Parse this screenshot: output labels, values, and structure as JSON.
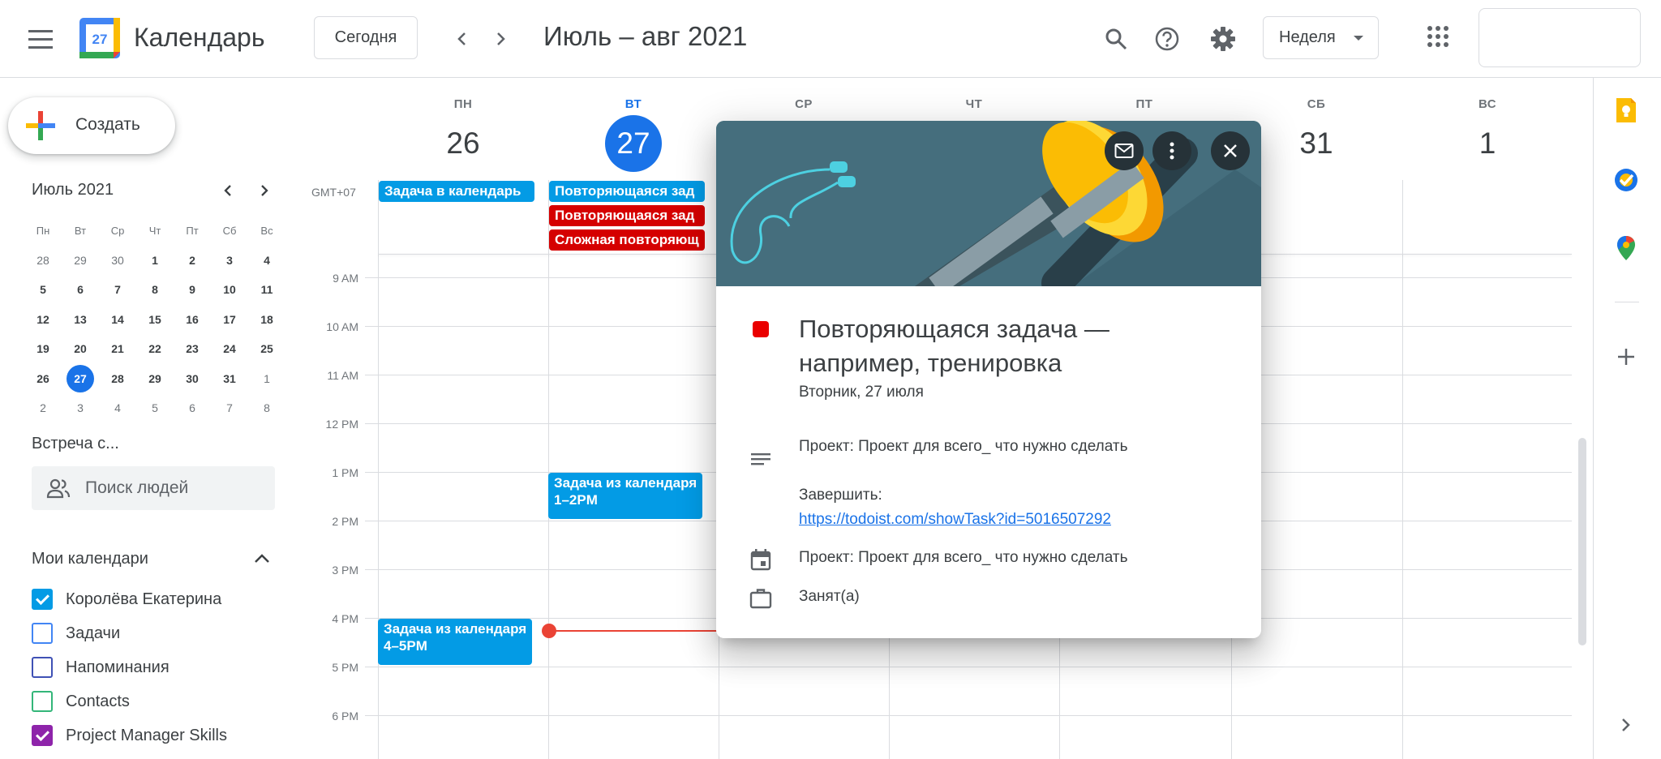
{
  "header": {
    "app_title": "Календарь",
    "logo_day": "27",
    "today_label": "Сегодня",
    "date_range": "Июль – авг 2021",
    "view_label": "Неделя"
  },
  "sidebar": {
    "create_label": "Создать",
    "mini_month": "Июль 2021",
    "weekday_heads": [
      "Пн",
      "Вт",
      "Ср",
      "Чт",
      "Пт",
      "Сб",
      "Вс"
    ],
    "weeks": [
      [
        "28",
        "29",
        "30",
        "1",
        "2",
        "3",
        "4"
      ],
      [
        "5",
        "6",
        "7",
        "8",
        "9",
        "10",
        "11"
      ],
      [
        "12",
        "13",
        "14",
        "15",
        "16",
        "17",
        "18"
      ],
      [
        "19",
        "20",
        "21",
        "22",
        "23",
        "24",
        "25"
      ],
      [
        "26",
        "27",
        "28",
        "29",
        "30",
        "31",
        "1"
      ],
      [
        "2",
        "3",
        "4",
        "5",
        "6",
        "7",
        "8"
      ]
    ],
    "meet_title": "Встреча с...",
    "people_search_placeholder": "Поиск людей",
    "my_calendars_title": "Мои календари",
    "calendars": [
      {
        "label": "Королёва Екатерина",
        "color": "#039be5",
        "checked": true
      },
      {
        "label": "Задачи",
        "color": "#4285f4",
        "checked": false
      },
      {
        "label": "Напоминания",
        "color": "#3f51b5",
        "checked": false
      },
      {
        "label": "Contacts",
        "color": "#33b679",
        "checked": false
      },
      {
        "label": "Project Manager Skills",
        "color": "#8e24aa",
        "checked": true
      }
    ]
  },
  "grid": {
    "timezone": "GMT+07",
    "days": [
      {
        "name": "ПН",
        "num": "26"
      },
      {
        "name": "ВТ",
        "num": "27"
      },
      {
        "name": "СР",
        "num": ""
      },
      {
        "name": "ЧТ",
        "num": ""
      },
      {
        "name": "ПТ",
        "num": ""
      },
      {
        "name": "СБ",
        "num": "31"
      },
      {
        "name": "ВС",
        "num": "1"
      }
    ],
    "hours": [
      "9 AM",
      "10 AM",
      "11 AM",
      "12 PM",
      "1 PM",
      "2 PM",
      "3 PM",
      "4 PM",
      "5 PM",
      "6 PM"
    ],
    "allday_events": [
      {
        "label": "Задача в календарь",
        "color": "#039be5"
      },
      {
        "label": "Повторяющаяся зад",
        "color": "#039be5"
      },
      {
        "label": "Повторяющаяся зад",
        "color": "#d50000"
      },
      {
        "label": "Сложная повторяющ",
        "color": "#d50000"
      }
    ],
    "timed_events": [
      {
        "title": "Задача из календаря",
        "time": "1–2PM"
      },
      {
        "title": "Задача из календаря",
        "time": "4–5PM"
      }
    ]
  },
  "popup": {
    "title": "Повторяющаяся задача — например, тренировка",
    "date": "Вторник, 27 июля",
    "description_project": "Проект: Проект для всего_ что нужно сделать",
    "complete_label": "Завершить:",
    "complete_link": "https://todoist.com/showTask?id=5016507292",
    "calendar_project": "Проект: Проект для всего_ что нужно сделать",
    "availability": "Занят(а)",
    "color": "#ea0000"
  }
}
